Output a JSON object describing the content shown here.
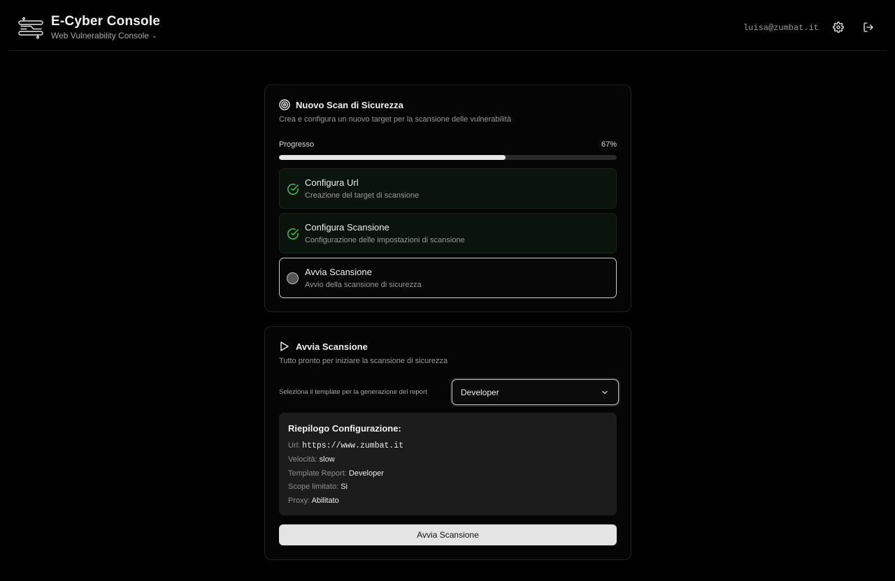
{
  "header": {
    "title": "E-Cyber Console",
    "subtitle": "Web Vulnerability Console",
    "user_email": "luisa@zumbat.it",
    "settings_icon": "gear-icon",
    "logout_icon": "logout-icon"
  },
  "new_scan": {
    "title": "Nuovo Scan di Sicurezza",
    "description": "Crea e configura un nuovo target per la scansione delle vulnerabilità",
    "progress_label": "Progresso",
    "progress_text": "67%",
    "progress_value": 0.67,
    "steps": [
      {
        "title": "Configura Url",
        "subtitle": "Creazione del target di scansione",
        "status": "done"
      },
      {
        "title": "Configura Scansione",
        "subtitle": "Configurazione delle impostazioni di scansione",
        "status": "done"
      },
      {
        "title": "Avvia Scansione",
        "subtitle": "Avvio della scansione di sicurezza",
        "status": "current"
      }
    ]
  },
  "start_scan": {
    "title": "Avvia Scansione",
    "description": "Tutto pronto per iniziare la scansione di sicurezza",
    "template_label": "Seleziona il template per la generazione del report",
    "template_value": "Developer",
    "summary": {
      "title": "Riepilogo Configurazione:",
      "rows": [
        {
          "label": "Url:",
          "value": "https://www.zumbat.it"
        },
        {
          "label": "Velocità:",
          "value": "slow"
        },
        {
          "label": "Template Report:",
          "value": "Developer"
        },
        {
          "label": "Scope limitato:",
          "value": "Si"
        },
        {
          "label": "Proxy:",
          "value": "Abilitato"
        }
      ]
    },
    "button_label": "Avvia Scansione"
  },
  "colors": {
    "background": "#000000",
    "check_green": "#3fb950",
    "done_step_bg": "#0a140d",
    "button_bg": "#e4e4e4"
  }
}
